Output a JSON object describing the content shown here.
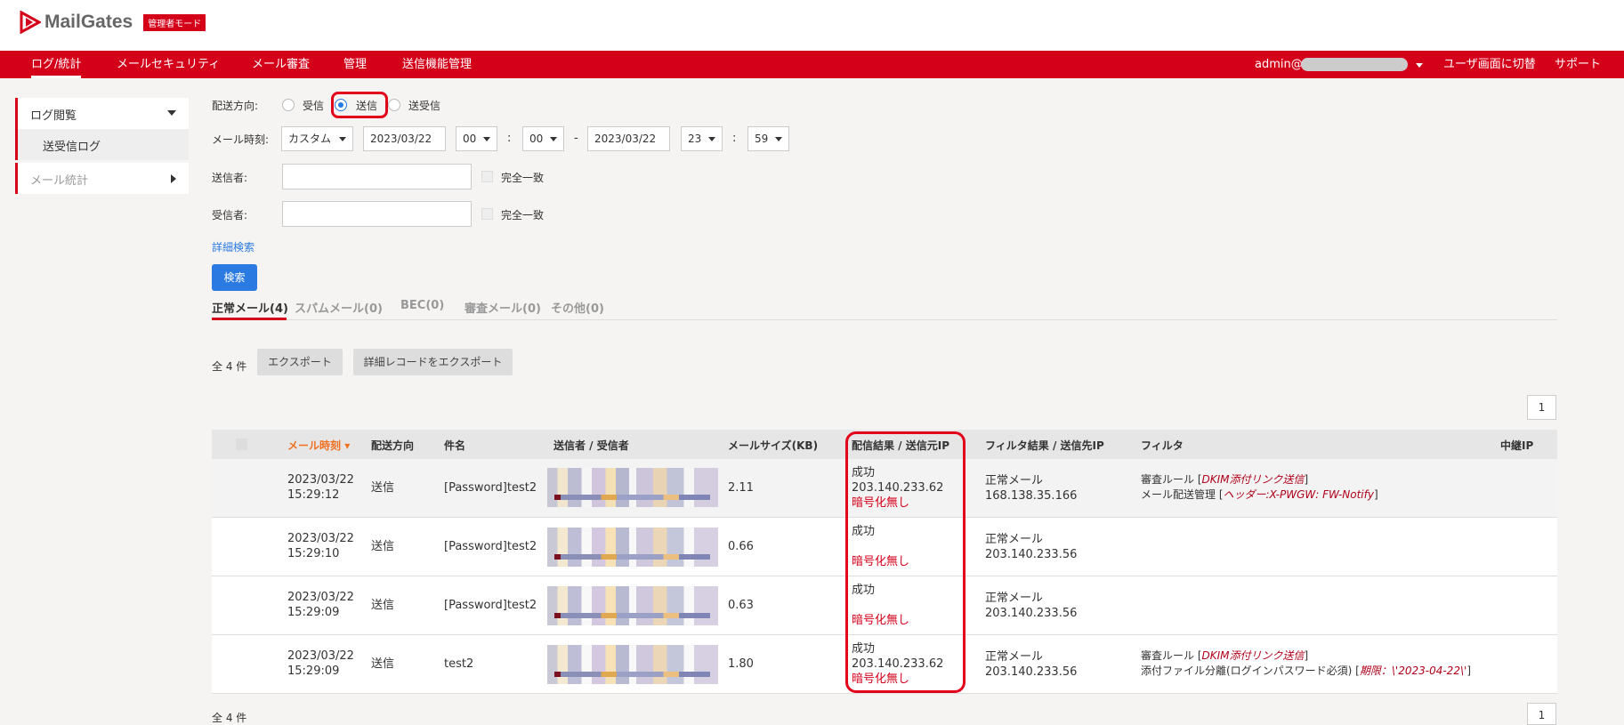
{
  "header": {
    "logo_text": "MailGates",
    "mode_badge": "管理者モード"
  },
  "nav": {
    "items": [
      "ログ/統計",
      "メールセキュリティ",
      "メール審査",
      "管理",
      "送信機能管理"
    ],
    "user": "admin@",
    "switch_label": "ユーザ画面に切替",
    "support_label": "サポート"
  },
  "sidebar": {
    "group1": "ログ閲覧",
    "sub1": "送受信ログ",
    "group2": "メール統計"
  },
  "filters": {
    "direction_label": "配送方向:",
    "dir_receive": "受信",
    "dir_send": "送信",
    "dir_both": "送受信",
    "time_label": "メール時刻:",
    "time_mode": "カスタム",
    "from_date": "2023/03/22",
    "from_hour": "00",
    "from_min": "00",
    "colon": ":",
    "dash": "-",
    "to_date": "2023/03/22",
    "to_hour": "23",
    "to_min": "59",
    "sender_label": "送信者:",
    "recipient_label": "受信者:",
    "exact_match": "完全一致",
    "advanced_search": "詳細検索",
    "search_button": "検索"
  },
  "tabs": [
    "正常メール(4)",
    "スパムメール(0)",
    "BEC(0)",
    "審査メール(0)",
    "その他(0)"
  ],
  "toolbar": {
    "count_text": "全 4 件",
    "export_button": "エクスポート",
    "export_detail_button": "詳細レコードをエクスポート",
    "page": "1"
  },
  "table": {
    "headers": {
      "time": "メール時刻",
      "direction": "配送方向",
      "subject": "件名",
      "sender_recipient": "送信者 / 受信者",
      "size": "メールサイズ(KB)",
      "delivery": "配信結果 / 送信元IP",
      "filter_result": "フィルタ結果 / 送信先IP",
      "filter": "フィルタ",
      "relay_ip": "中継IP"
    },
    "rows": [
      {
        "date": "2023/03/22",
        "time": "15:29:12",
        "direction": "送信",
        "subject": "[Password]test2",
        "size": "2.11",
        "result": "成功",
        "src_ip": "203.140.233.62",
        "encryption": "暗号化無し",
        "filter_result": "正常メール",
        "dest_ip": "168.138.35.166",
        "filter1_prefix": "審査ルール [",
        "filter1_em": "DKIM添付リンク送信",
        "filter1_suffix": "]",
        "filter2_prefix": "メール配送管理 [",
        "filter2_em": "ヘッダー:X-PWGW: FW-Notify",
        "filter2_suffix": "]"
      },
      {
        "date": "2023/03/22",
        "time": "15:29:10",
        "direction": "送信",
        "subject": "[Password]test2",
        "size": "0.66",
        "result": "成功",
        "src_ip": "",
        "encryption": "暗号化無し",
        "filter_result": "正常メール",
        "dest_ip": "203.140.233.56"
      },
      {
        "date": "2023/03/22",
        "time": "15:29:09",
        "direction": "送信",
        "subject": "[Password]test2",
        "size": "0.63",
        "result": "成功",
        "src_ip": "",
        "encryption": "暗号化無し",
        "filter_result": "正常メール",
        "dest_ip": "203.140.233.56"
      },
      {
        "date": "2023/03/22",
        "time": "15:29:09",
        "direction": "送信",
        "subject": "test2",
        "size": "1.80",
        "result": "成功",
        "src_ip": "203.140.233.62",
        "encryption": "暗号化無し",
        "filter_result": "正常メール",
        "dest_ip": "203.140.233.56",
        "filter1_prefix": "審査ルール [",
        "filter1_em": "DKIM添付リンク送信",
        "filter1_suffix": "]",
        "filter2_prefix": "添付ファイル分離(ログインパスワード必須) [",
        "filter2_em": "期限：\\'2023-04-22\\'",
        "filter2_suffix": "]"
      }
    ]
  },
  "footer": {
    "count_text": "全 4 件",
    "page": "1"
  },
  "colors": {
    "brand_red": "#d4001a",
    "accent_blue": "#2a7ae2",
    "sort_orange": "#f07020"
  }
}
